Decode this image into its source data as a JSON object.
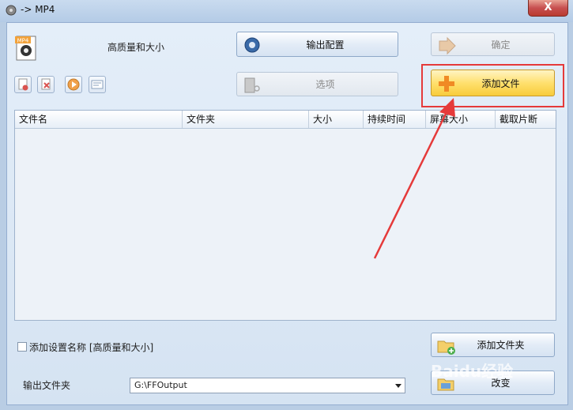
{
  "window": {
    "title": "-> MP4",
    "close_label": "X"
  },
  "profile": {
    "icon_badge": "MP4",
    "name": "高质量和大小"
  },
  "toolbar": {
    "output_config_label": "输出配置",
    "ok_label": "确定",
    "options_label": "选项",
    "add_file_label": "添加文件",
    "add_folder_label": "添加文件夹",
    "change_label": "改变"
  },
  "file_table": {
    "columns": [
      "文件名",
      "文件夹",
      "大小",
      "持续时间",
      "屏幕大小",
      "截取片断"
    ]
  },
  "footer": {
    "add_setting_name_label": "添加设置名称 [高质量和大小]",
    "output_folder_label": "输出文件夹",
    "output_folder_value": "G:\\FFOutput"
  },
  "watermark": "Baidu经验",
  "colors": {
    "accent_red": "#e53a3a",
    "add_button_yellow": "#ffe06e"
  }
}
